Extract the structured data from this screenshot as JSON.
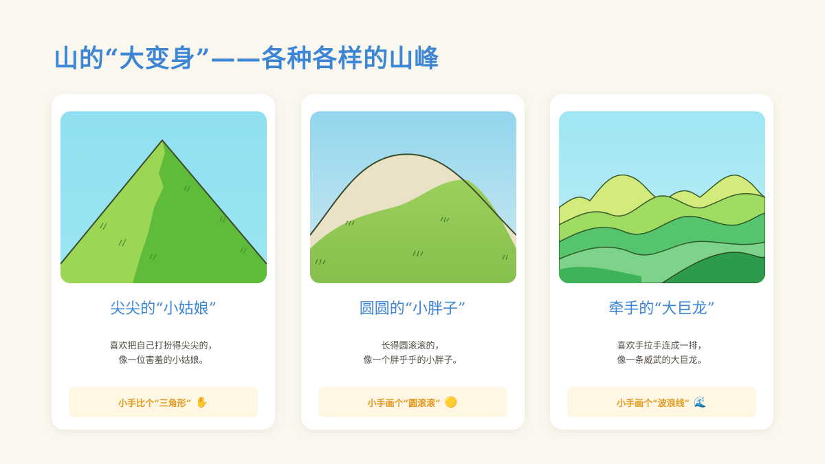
{
  "page": {
    "title": "山的“大变身”——各种各样的山峰"
  },
  "cards": [
    {
      "title": "尖尖的“小姑娘”",
      "desc_line1": "喜欢把自己打扮得尖尖的，",
      "desc_line2": "像一位害羞的小姑娘。",
      "action_label": "小手比个“三角形”",
      "action_emoji": "✋",
      "illustration_icon": "pointed-mountain-illustration"
    },
    {
      "title": "圆圆的“小胖子”",
      "desc_line1": "长得圆滚滚的，",
      "desc_line2": "像一个胖乎乎的小胖子。",
      "action_label": "小手画个“圆滚滚”",
      "action_emoji": "🟡",
      "illustration_icon": "round-mountain-illustration"
    },
    {
      "title": "牵手的“大巨龙”",
      "desc_line1": "喜欢手拉手连成一排，",
      "desc_line2": "像一条威武的大巨龙。",
      "action_label": "小手画个“波浪线”",
      "action_emoji": "🌊",
      "illustration_icon": "wavy-mountain-range-illustration"
    }
  ],
  "colors": {
    "background": "#faf7ef",
    "accent_blue": "#3d86d6",
    "action_text": "#e09a22",
    "action_bg": "#fff6e3"
  }
}
